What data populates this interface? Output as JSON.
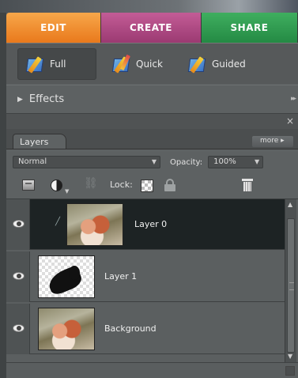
{
  "tabs": [
    {
      "label": "EDIT",
      "color": "#e9791c"
    },
    {
      "label": "CREATE",
      "color": "#9b3a72"
    },
    {
      "label": "SHARE",
      "color": "#248a44"
    }
  ],
  "modes": [
    {
      "label": "Full",
      "active": true
    },
    {
      "label": "Quick",
      "active": false
    },
    {
      "label": "Guided",
      "active": false
    }
  ],
  "effects": {
    "label": "Effects"
  },
  "close_glyph": "×",
  "layers_panel": {
    "tab_label": "Layers",
    "more_label": "more ▸",
    "blend_mode": "Normal",
    "opacity_label": "Opacity:",
    "opacity_value": "100%",
    "lock_label": "Lock:",
    "layers": [
      {
        "name": "Layer 0",
        "thumbnail": "photo",
        "selected": true,
        "visible": true
      },
      {
        "name": "Layer 1",
        "thumbnail": "mask",
        "selected": false,
        "visible": true
      },
      {
        "name": "Background",
        "thumbnail": "photo",
        "selected": false,
        "visible": true
      }
    ]
  }
}
